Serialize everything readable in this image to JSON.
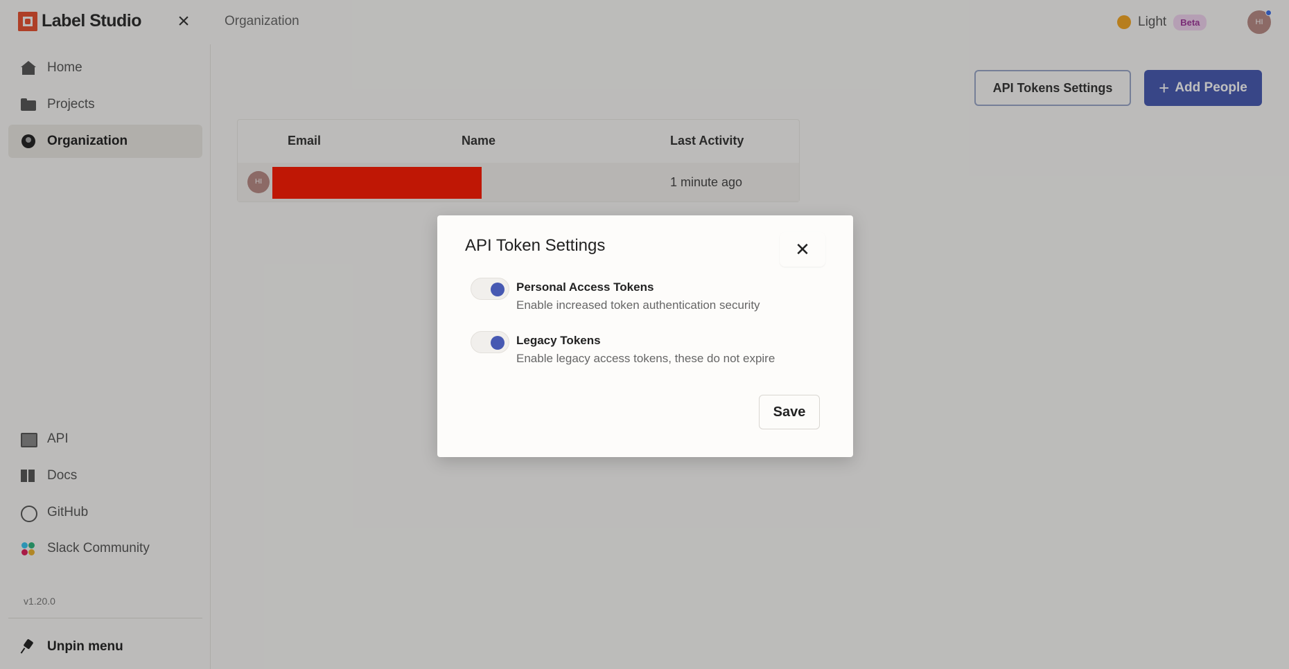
{
  "app": {
    "name": "Label Studio"
  },
  "header": {
    "page_title": "Organization",
    "theme_label": "Light",
    "beta_badge": "Beta",
    "avatar_initials": "HI"
  },
  "sidebar": {
    "items": [
      {
        "label": "Home",
        "icon": "home-icon"
      },
      {
        "label": "Projects",
        "icon": "folder-icon"
      },
      {
        "label": "Organization",
        "icon": "organization-icon",
        "active": true
      },
      {
        "label": "API",
        "icon": "api-icon"
      },
      {
        "label": "Docs",
        "icon": "docs-icon"
      },
      {
        "label": "GitHub",
        "icon": "github-icon"
      },
      {
        "label": "Slack Community",
        "icon": "slack-icon"
      }
    ],
    "version": "v1.20.0",
    "unpin_label": "Unpin menu"
  },
  "main": {
    "api_tokens_button": "API Tokens Settings",
    "add_people_button": "Add People",
    "table": {
      "columns": [
        "Email",
        "Name",
        "Last Activity"
      ],
      "rows": [
        {
          "avatar_initials": "HI",
          "last_activity": "1 minute ago"
        }
      ]
    }
  },
  "modal": {
    "title": "API Token Settings",
    "settings": [
      {
        "label": "Personal Access Tokens",
        "description": "Enable increased token authentication security",
        "enabled": true
      },
      {
        "label": "Legacy Tokens",
        "description": "Enable legacy access tokens, these do not expire",
        "enabled": true
      }
    ],
    "save_label": "Save"
  },
  "colors": {
    "accent": "#4759b2",
    "brand": "#e8502f",
    "redaction": "#ff1a00"
  }
}
